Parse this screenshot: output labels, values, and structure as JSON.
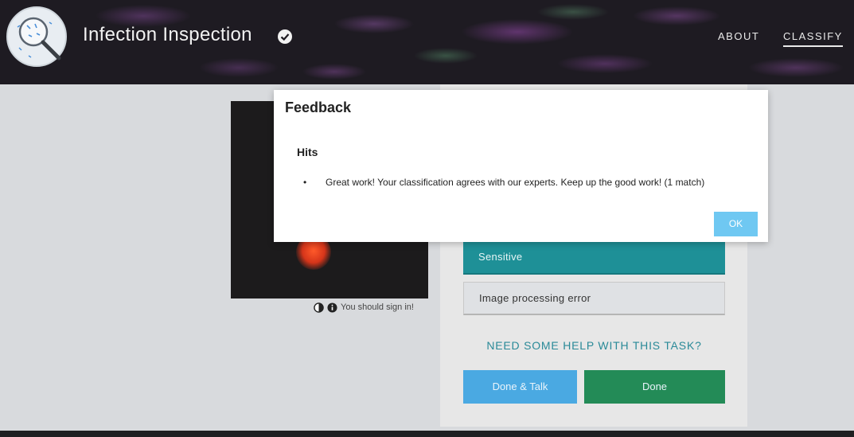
{
  "header": {
    "title": "Infection Inspection",
    "nav": {
      "about": "ABOUT",
      "classify": "CLASSIFY"
    }
  },
  "subject": {
    "toolbar_text": "You should sign in!",
    "icons": [
      "contrast-icon",
      "info-icon"
    ]
  },
  "task": {
    "answers": [
      "Sensitive",
      "Image processing error"
    ],
    "help_link": "NEED SOME HELP WITH THIS TASK?",
    "done_talk": "Done & Talk",
    "done": "Done"
  },
  "modal": {
    "title": "Feedback",
    "section": "Hits",
    "bullet": "•",
    "message": "Great work! Your classification agrees with our experts. Keep up the good work! (1 match)",
    "ok": "OK"
  },
  "colors": {
    "header_bg": "#1e1b22",
    "teal": "#1e9097",
    "blue": "#4aa9e2",
    "green": "#238b57",
    "ok": "#6fc8f2"
  }
}
